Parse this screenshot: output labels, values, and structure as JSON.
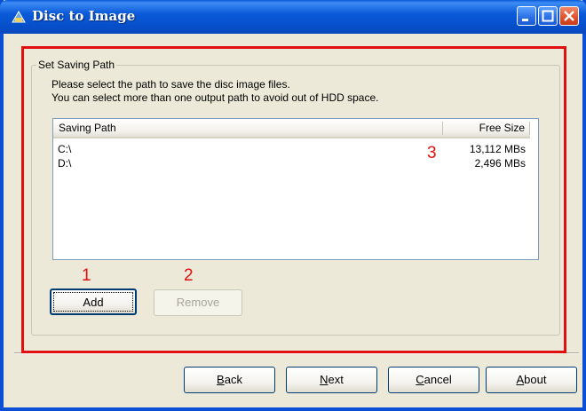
{
  "window": {
    "title": "Disc to Image",
    "icon": "disc-image-app-icon"
  },
  "group": {
    "legend": "Set Saving Path",
    "info_line1": "Please select the path to save the disc image files.",
    "info_line2": "You can select more than one output path to avoid out of HDD space."
  },
  "list": {
    "columns": [
      "Saving Path",
      "Free Size"
    ],
    "rows": [
      {
        "path": "C:\\",
        "size": "13,112 MBs"
      },
      {
        "path": "D:\\",
        "size": "2,496 MBs"
      }
    ]
  },
  "buttons": {
    "add": "Add",
    "remove": "Remove",
    "back": {
      "mnemonic": "B",
      "rest": "ack"
    },
    "next": {
      "mnemonic": "N",
      "rest": "ext"
    },
    "cancel": {
      "mnemonic": "C",
      "rest": "ancel"
    },
    "about": {
      "mnemonic": "A",
      "rest": "bout"
    }
  },
  "annotations": {
    "marker1": "1",
    "marker2": "2",
    "marker3": "3",
    "color": "#e01010"
  }
}
